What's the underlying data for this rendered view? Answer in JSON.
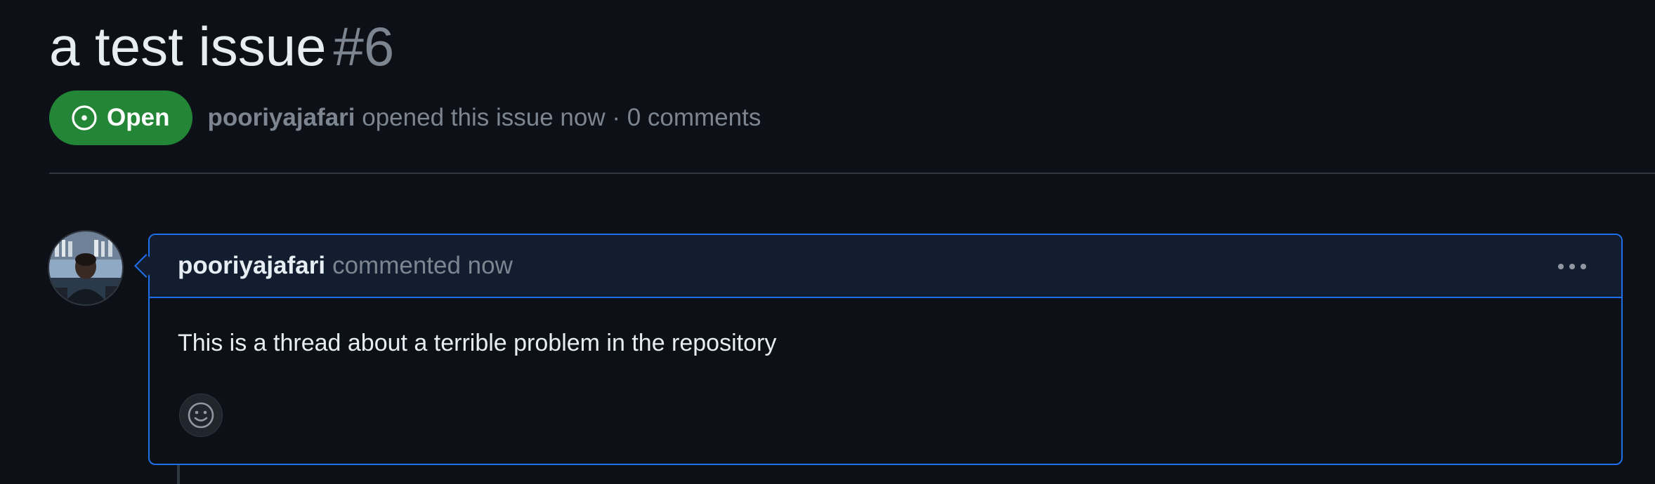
{
  "issue": {
    "title": "a test issue",
    "number": "#6",
    "state_label": "Open",
    "author": "pooriyajafari",
    "meta_text": " opened this issue now · 0 comments"
  },
  "comment": {
    "author": "pooriyajafari",
    "time_text": "commented now",
    "body": "This is a thread about a terrible problem in the repository"
  },
  "icons": {
    "state": "issue-opened-icon",
    "menu": "kebab-horizontal-icon",
    "reaction": "smiley-icon"
  },
  "colors": {
    "background": "#0d1117",
    "open_green": "#238636",
    "accent_blue": "#1f6feb",
    "muted": "#7d8590"
  }
}
